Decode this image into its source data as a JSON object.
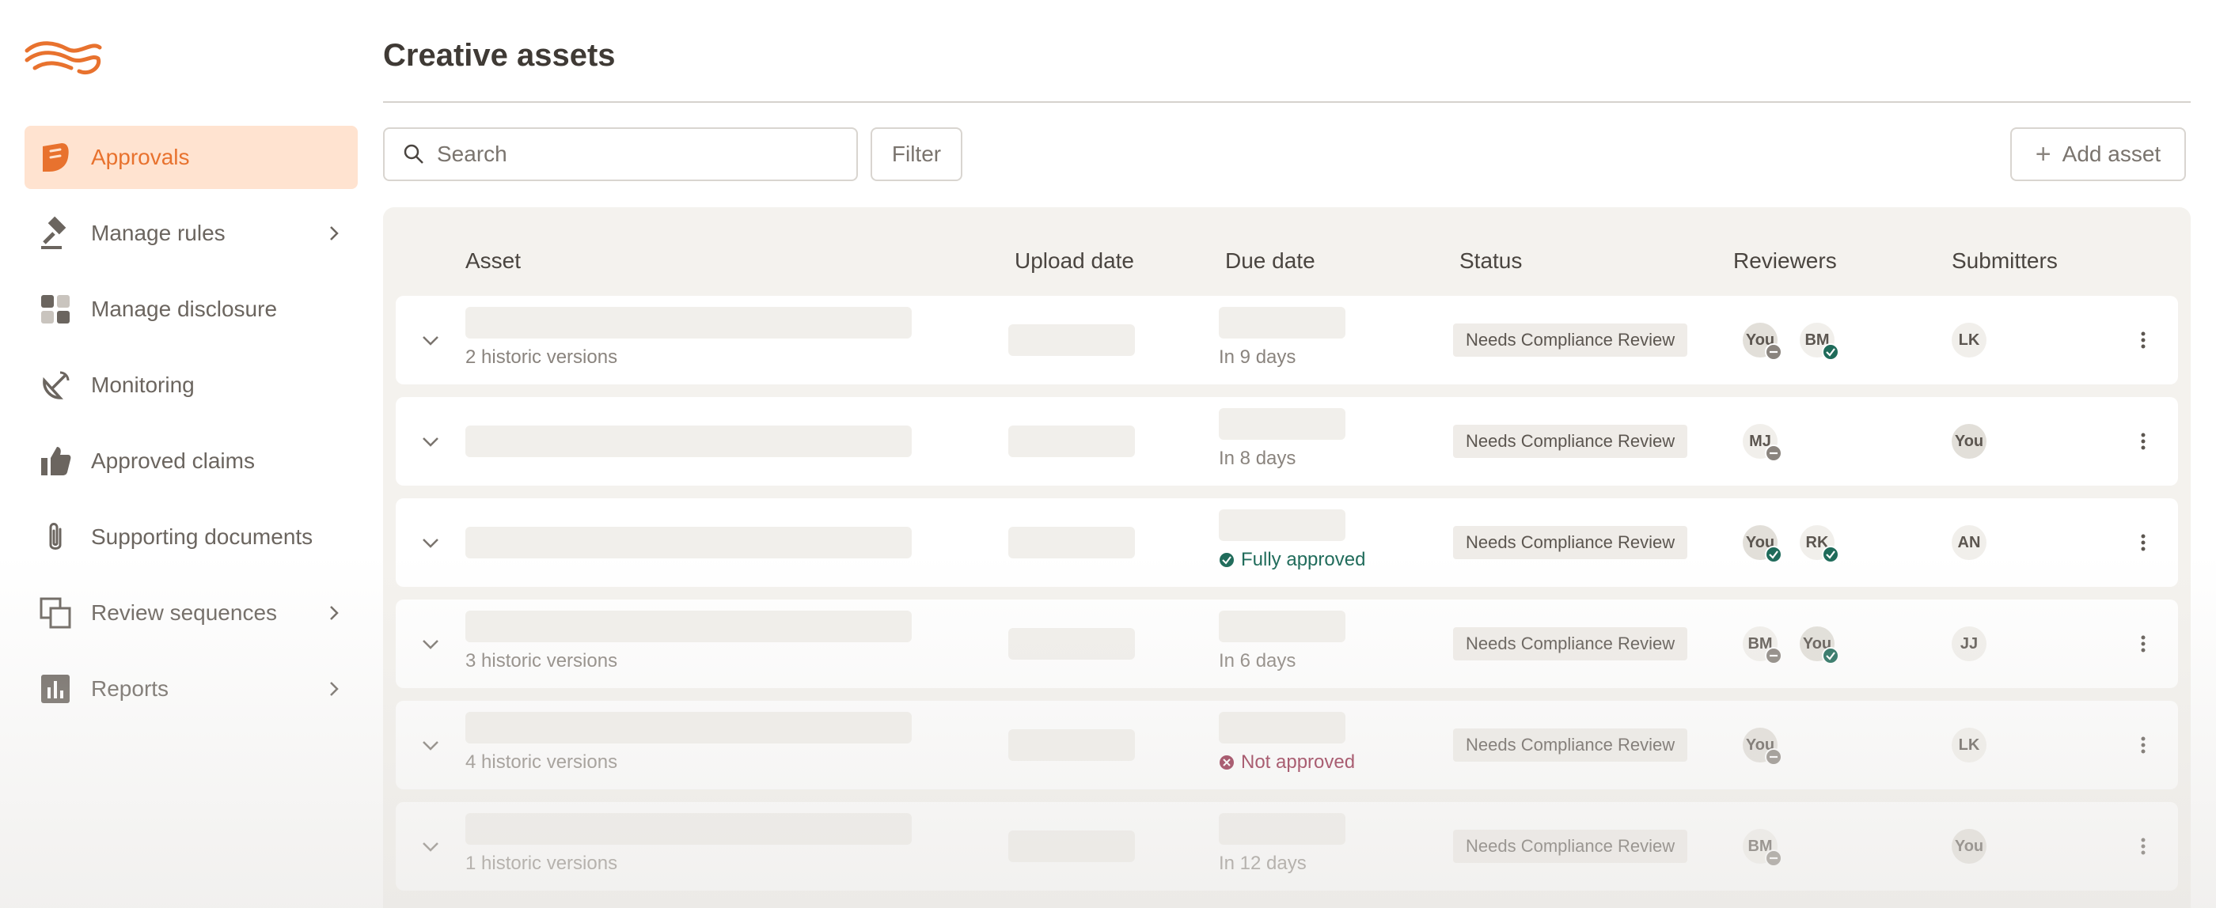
{
  "app": {
    "logo_icon": "wave-logo-icon",
    "accent": "#e8722e"
  },
  "sidebar": {
    "items": [
      {
        "label": "Approvals",
        "icon": "approvals-icon",
        "active": true
      },
      {
        "label": "Manage rules",
        "icon": "gavel-icon",
        "chevron": true
      },
      {
        "label": "Manage disclosure",
        "icon": "grid-icon"
      },
      {
        "label": "Monitoring",
        "icon": "satellite-icon"
      },
      {
        "label": "Approved claims",
        "icon": "thumbs-up-icon"
      },
      {
        "label": "Supporting documents",
        "icon": "paperclip-icon"
      },
      {
        "label": "Review sequences",
        "icon": "stacked-pages-icon",
        "chevron": true
      },
      {
        "label": "Reports",
        "icon": "bar-chart-icon",
        "chevron": true
      }
    ]
  },
  "main": {
    "title": "Creative assets",
    "search": {
      "placeholder": "Search",
      "value": ""
    },
    "filter_label": "Filter",
    "add_label": "Add asset"
  },
  "table": {
    "columns": {
      "asset": "Asset",
      "upload": "Upload date",
      "due": "Due date",
      "status": "Status",
      "reviewers": "Reviewers",
      "submitters": "Submitters"
    },
    "rows": [
      {
        "versions": "2 historic versions",
        "due": "In 9 days",
        "due_state": "",
        "status": "Needs Compliance Review",
        "reviewers": [
          {
            "initials": "You",
            "state": "pending"
          },
          {
            "initials": "BM",
            "state": "approved"
          }
        ],
        "submitter": "LK"
      },
      {
        "versions": "",
        "due": "In 8 days",
        "due_state": "",
        "status": "Needs Compliance Review",
        "reviewers": [
          {
            "initials": "MJ",
            "state": "pending"
          }
        ],
        "submitter": "You"
      },
      {
        "versions": "",
        "due": "Fully approved",
        "due_state": "approved",
        "status": "Needs Compliance Review",
        "reviewers": [
          {
            "initials": "You",
            "state": "approved"
          },
          {
            "initials": "RK",
            "state": "approved"
          }
        ],
        "submitter": "AN"
      },
      {
        "versions": "3 historic versions",
        "due": "In 6 days",
        "due_state": "",
        "status": "Needs Compliance Review",
        "reviewers": [
          {
            "initials": "BM",
            "state": "pending"
          },
          {
            "initials": "You",
            "state": "approved"
          }
        ],
        "submitter": "JJ"
      },
      {
        "versions": "4 historic versions",
        "due": "Not approved",
        "due_state": "rejected",
        "status": "Needs Compliance Review",
        "reviewers": [
          {
            "initials": "You",
            "state": "pending"
          }
        ],
        "submitter": "LK"
      },
      {
        "versions": "1 historic versions",
        "due": "In 12 days",
        "due_state": "",
        "status": "Needs Compliance Review",
        "reviewers": [
          {
            "initials": "BM",
            "state": "pending"
          }
        ],
        "submitter": "You"
      }
    ]
  }
}
